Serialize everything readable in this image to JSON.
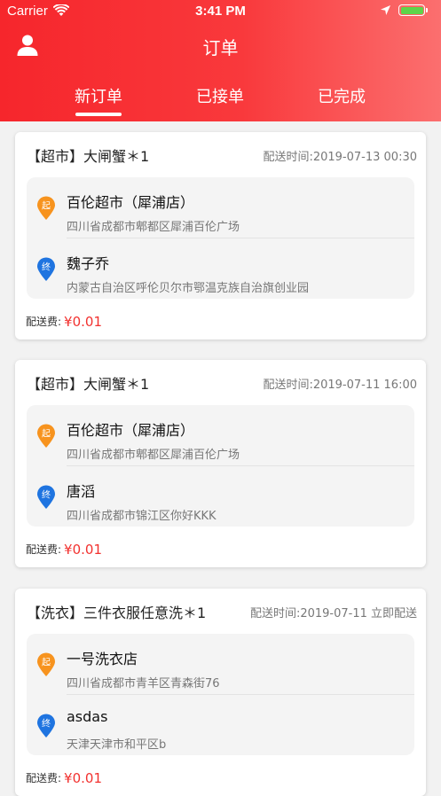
{
  "status_bar": {
    "carrier": "Carrier",
    "time": "3:41 PM"
  },
  "header": {
    "title": "订单"
  },
  "tabs": [
    {
      "label": "新订单",
      "active": true
    },
    {
      "label": "已接单",
      "active": false
    },
    {
      "label": "已完成",
      "active": false
    }
  ],
  "colors": {
    "accent": "#f6262c",
    "price": "#f2312f",
    "pickup_pin": "#f7931e",
    "dropoff_pin": "#1f74e0"
  },
  "orders": [
    {
      "title": "【超市】大闸蟹＊1",
      "delivery_time": "配送时间:2019-07-13 00:30",
      "from": {
        "badge": "起",
        "name": "百伦超市（犀浦店）",
        "address": "四川省成都市郫都区犀浦百伦广场"
      },
      "to": {
        "badge": "终",
        "name": "魏子乔",
        "address": "内蒙古自治区呼伦贝尔市鄂温克族自治旗创业园"
      },
      "fee_label": "配送费:",
      "fee": "¥0.01"
    },
    {
      "title": "【超市】大闸蟹＊1",
      "delivery_time": "配送时间:2019-07-11 16:00",
      "from": {
        "badge": "起",
        "name": "百伦超市（犀浦店）",
        "address": "四川省成都市郫都区犀浦百伦广场"
      },
      "to": {
        "badge": "终",
        "name": "唐滔",
        "address": "四川省成都市锦江区你好KKK"
      },
      "fee_label": "配送费:",
      "fee": "¥0.01"
    },
    {
      "title": "【洗衣】三件衣服任意洗＊1",
      "delivery_time": "配送时间:2019-07-11 立即配送",
      "from": {
        "badge": "起",
        "name": "一号洗衣店",
        "address": "四川省成都市青羊区青森街76"
      },
      "to": {
        "badge": "终",
        "name": "asdas",
        "address": "天津天津市和平区b"
      },
      "fee_label": "配送费:",
      "fee": "¥0.01"
    }
  ]
}
